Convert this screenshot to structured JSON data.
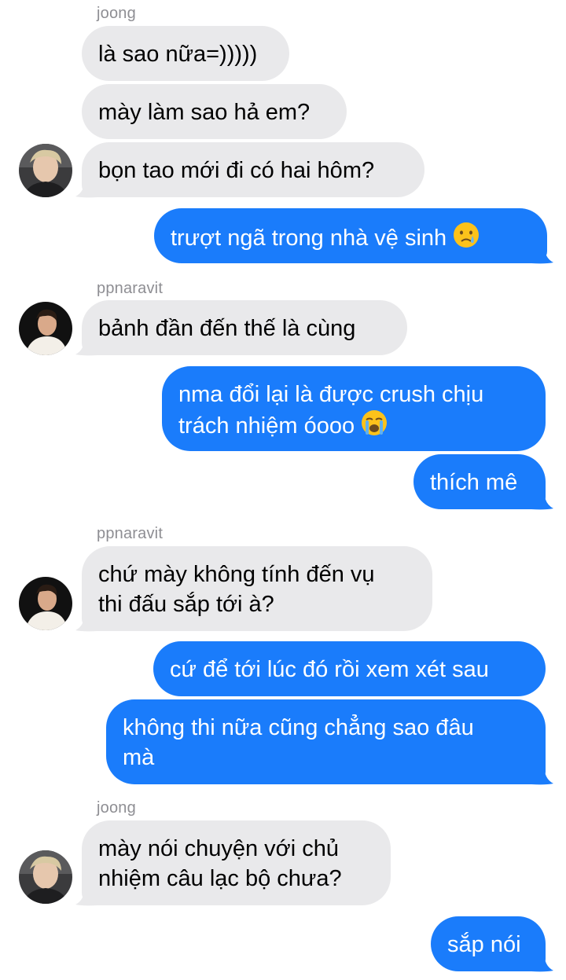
{
  "messages": [
    {
      "sender": "joong",
      "text": "là sao nữa=)))))"
    },
    {
      "text": "mày làm sao hả em?"
    },
    {
      "text": "bọn tao mới đi có hai hôm?"
    },
    {
      "outgoing": true,
      "text": "trượt ngã trong nhà vệ sinh",
      "emoji": "crying-face-icon"
    },
    {
      "sender": "ppnaravit",
      "text": "bảnh đần đến thế là cùng"
    },
    {
      "outgoing": true,
      "lines": [
        "nma đổi lại là được crush chịu",
        "trách nhiệm óooo"
      ],
      "emoji": "loudly-crying-face-icon"
    },
    {
      "outgoing": true,
      "text": "thích mê"
    },
    {
      "sender": "ppnaravit",
      "lines": [
        "chứ mày không tính đến vụ",
        "thi đấu sắp tới à?"
      ]
    },
    {
      "outgoing": true,
      "text": "cứ để tới lúc đó rồi xem xét sau"
    },
    {
      "outgoing": true,
      "lines": [
        "không thi nữa cũng chẳng sao đâu",
        "mà"
      ]
    },
    {
      "sender": "joong",
      "lines": [
        "mày nói chuyện với chủ",
        "nhiệm câu lạc bộ chưa?"
      ]
    },
    {
      "outgoing": true,
      "text": "sắp nói"
    }
  ],
  "senders": {
    "a": "joong",
    "b": "ppnaravit",
    "c": "ppnaravit",
    "d": "joong"
  },
  "colors": {
    "outgoing_bubble": "#1a7cfb",
    "incoming_bubble": "#e9e9eb",
    "sender_label": "#8e8e93"
  }
}
